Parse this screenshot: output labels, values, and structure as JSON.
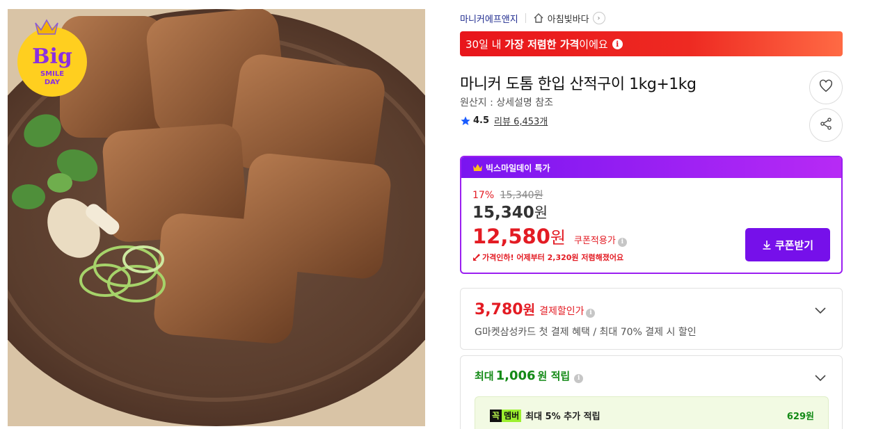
{
  "image": {
    "badge": {
      "big": "Big",
      "line1": "SMILE",
      "line2": "DAY"
    }
  },
  "seller": {
    "name": "마니커에프앤지",
    "store": "아침빛바다"
  },
  "banner": {
    "prefix": "30일 내 ",
    "highlight": "가장 저렴한 가격",
    "suffix": "이에요"
  },
  "product": {
    "title": "마니커 도톰 한입 산적구이 1kg+1kg",
    "origin": "원산지 : 상세설명 참조",
    "rating": "4.5",
    "review_label": "리뷰",
    "review_count": "6,453개"
  },
  "deal": {
    "header": "빅스마일데이 특가",
    "discount_rate": "17%",
    "original_price": "15,340원",
    "price": "15,340",
    "price_unit": "원",
    "coupon_price": "12,580",
    "coupon_unit": "원",
    "coupon_label": "쿠폰적용가",
    "drop_notice": "가격인하! 어제부터 2,320원 저렴해졌어요",
    "coupon_button": "쿠폰받기"
  },
  "payment": {
    "amount": "3,780",
    "unit": "원",
    "label": "결제할인가",
    "description": "G마켓삼성카드 첫 결제 혜택 / 최대 70% 결제 시 할인"
  },
  "points": {
    "prefix": "최대",
    "amount": "1,006",
    "suffix": "원 적립",
    "member_badge_a": "꼭",
    "member_badge_b": "멤버",
    "member_text": "최대 5% 추가 적립",
    "member_points": "629원"
  },
  "colors": {
    "accent_red": "#e31b23",
    "deal_purple": "#7610ea",
    "points_green": "#138a16"
  }
}
